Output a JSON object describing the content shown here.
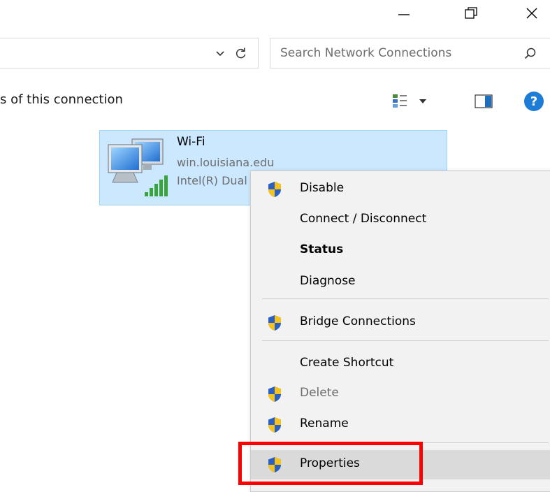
{
  "window": {
    "minimize_icon": "minimize-icon",
    "maximize_icon": "maximize-icon",
    "close_icon": "close-icon"
  },
  "address": {
    "dropdown_icon": "chevron-down-icon",
    "refresh_icon": "refresh-icon"
  },
  "search": {
    "placeholder": "Search Network Connections",
    "value": "",
    "icon": "search-icon"
  },
  "command_bar": {
    "text": "s of this connection",
    "view_icon": "view-options-icon",
    "preview_icon": "preview-pane-icon",
    "help_label": "?"
  },
  "connection": {
    "name": "Wi-Fi",
    "domain": "win.louisiana.edu",
    "adapter": "Intel(R) Dual Band Wireless",
    "icon": "wifi-adapter-icon"
  },
  "context_menu": {
    "items": [
      {
        "label": "Disable",
        "shield": true
      },
      {
        "label": "Connect / Disconnect",
        "shield": false
      },
      {
        "label": "Status",
        "shield": false,
        "bold": true
      },
      {
        "label": "Diagnose",
        "shield": false
      },
      {
        "label": "Bridge Connections",
        "shield": true
      },
      {
        "label": "Create Shortcut",
        "shield": false
      },
      {
        "label": "Delete",
        "shield": true,
        "disabled": true
      },
      {
        "label": "Rename",
        "shield": true
      },
      {
        "label": "Properties",
        "shield": true,
        "hovered": true
      }
    ]
  },
  "colors": {
    "selection_bg": "#cce8ff",
    "highlight_border": "#ff0000",
    "help_blue": "#1c7cd6",
    "shield_blue": "#2a5fc4",
    "shield_yellow": "#f6c21c"
  }
}
